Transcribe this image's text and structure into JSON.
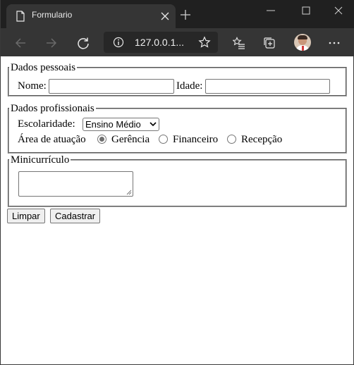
{
  "browser": {
    "tab_title": "Formulario",
    "url": "127.0.0.1..."
  },
  "form": {
    "pessoais": {
      "legend": "Dados pessoais",
      "nome_label": "Nome:",
      "nome_value": "",
      "idade_label": "Idade:",
      "idade_value": ""
    },
    "profissionais": {
      "legend": "Dados profissionais",
      "escolaridade_label": "Escolaridade:",
      "escolaridade_selected": "Ensino Médio",
      "area_label": "Área de atuação",
      "area_options": [
        {
          "label": "Gerência",
          "checked": true
        },
        {
          "label": "Financeiro",
          "checked": false
        },
        {
          "label": "Recepção",
          "checked": false
        }
      ]
    },
    "curriculo": {
      "legend": "Minicurrículo",
      "value": ""
    },
    "buttons": {
      "limpar": "Limpar",
      "cadastrar": "Cadastrar"
    }
  }
}
